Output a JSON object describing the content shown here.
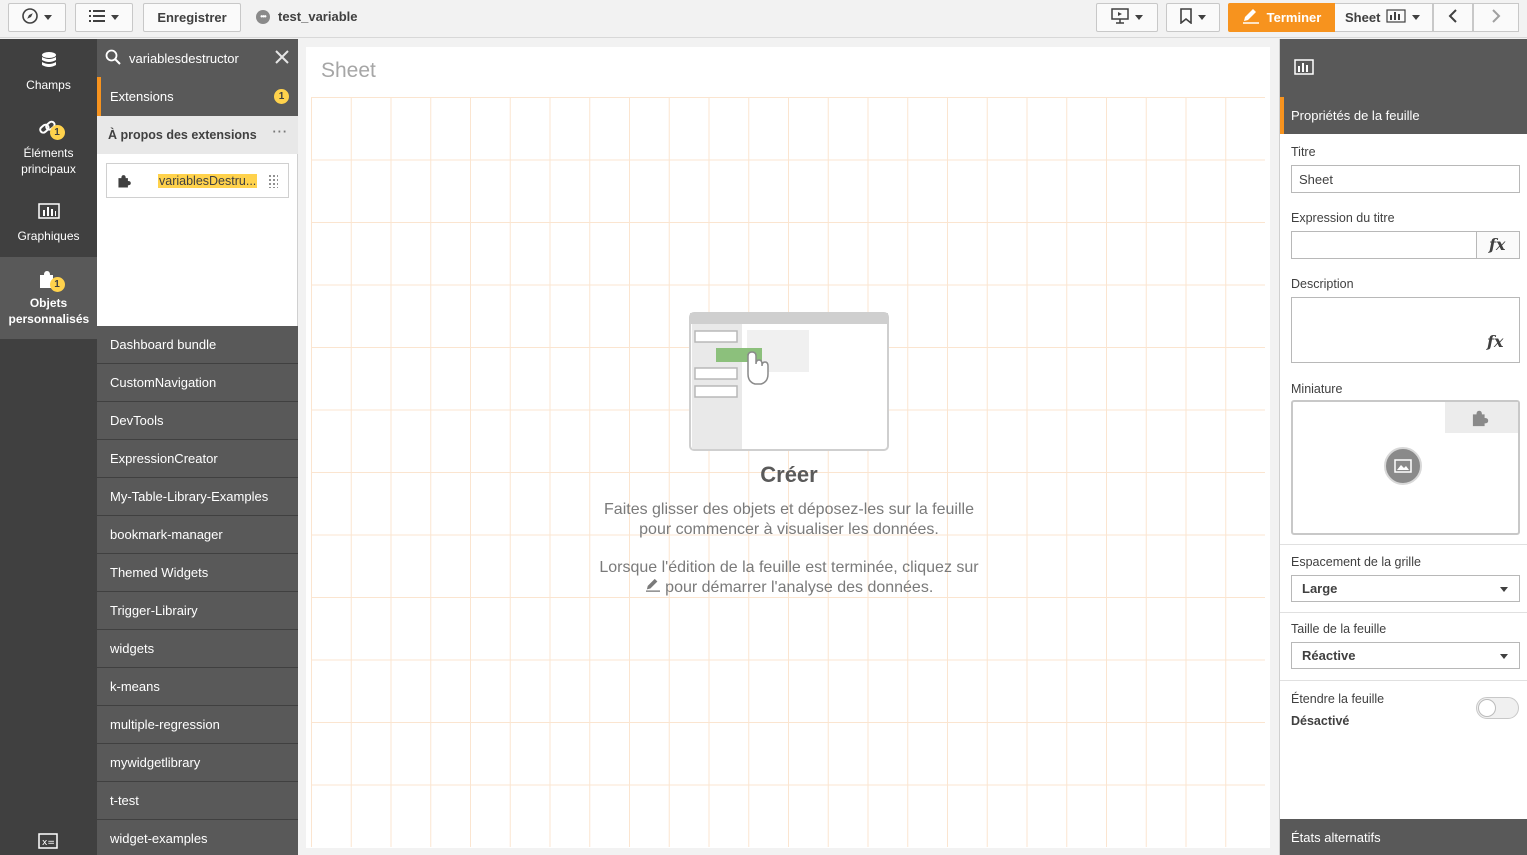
{
  "toolbar": {
    "save_label": "Enregistrer",
    "app_name": "test_variable",
    "done_label": "Terminer",
    "sheet_label": "Sheet"
  },
  "rail": {
    "items": [
      {
        "label": "Champs",
        "icon": "database-icon"
      },
      {
        "label": "Éléments principaux",
        "icon": "link-icon",
        "badge": "1"
      },
      {
        "label": "Graphiques",
        "icon": "bar-chart-icon"
      },
      {
        "label": "Objets personnalisés",
        "icon": "puzzle-icon",
        "badge": "1",
        "active": true
      }
    ]
  },
  "assets": {
    "search_value": "variablesdestructor",
    "extensions_label": "Extensions",
    "extensions_count": "1",
    "about_label": "À propos des extensions",
    "result_name": "variablesDestru...",
    "libraries": [
      "Dashboard bundle",
      "CustomNavigation",
      "DevTools",
      "ExpressionCreator",
      "My-Table-Library-Examples",
      "bookmark-manager",
      "Themed Widgets",
      "Trigger-Librairy",
      "widgets",
      "k-means",
      "multiple-regression",
      "mywidgetlibrary",
      "t-test",
      "widget-examples"
    ]
  },
  "canvas": {
    "sheet_title": "Sheet",
    "create_title": "Créer",
    "hint_line1": "Faites glisser des objets et déposez-les sur la feuille",
    "hint_line2": "pour commencer à visualiser les données.",
    "hint_line3": "Lorsque l'édition de la feuille est terminée, cliquez sur",
    "hint_line4": "pour démarrer l'analyse des données."
  },
  "properties": {
    "header": "Propriétés de la feuille",
    "title_label": "Titre",
    "title_value": "Sheet",
    "title_expr_label": "Expression du titre",
    "title_expr_value": "",
    "description_label": "Description",
    "description_value": "",
    "thumbnail_label": "Miniature",
    "grid_label": "Espacement de la grille",
    "grid_value": "Large",
    "size_label": "Taille de la feuille",
    "size_value": "Réactive",
    "extend_label": "Étendre la feuille",
    "extend_value": "Désactivé",
    "alt_states": "États alternatifs"
  },
  "colors": {
    "accent": "#f7931e",
    "panel_dark": "#595959",
    "rail": "#404040",
    "highlight": "#ffd24c"
  }
}
